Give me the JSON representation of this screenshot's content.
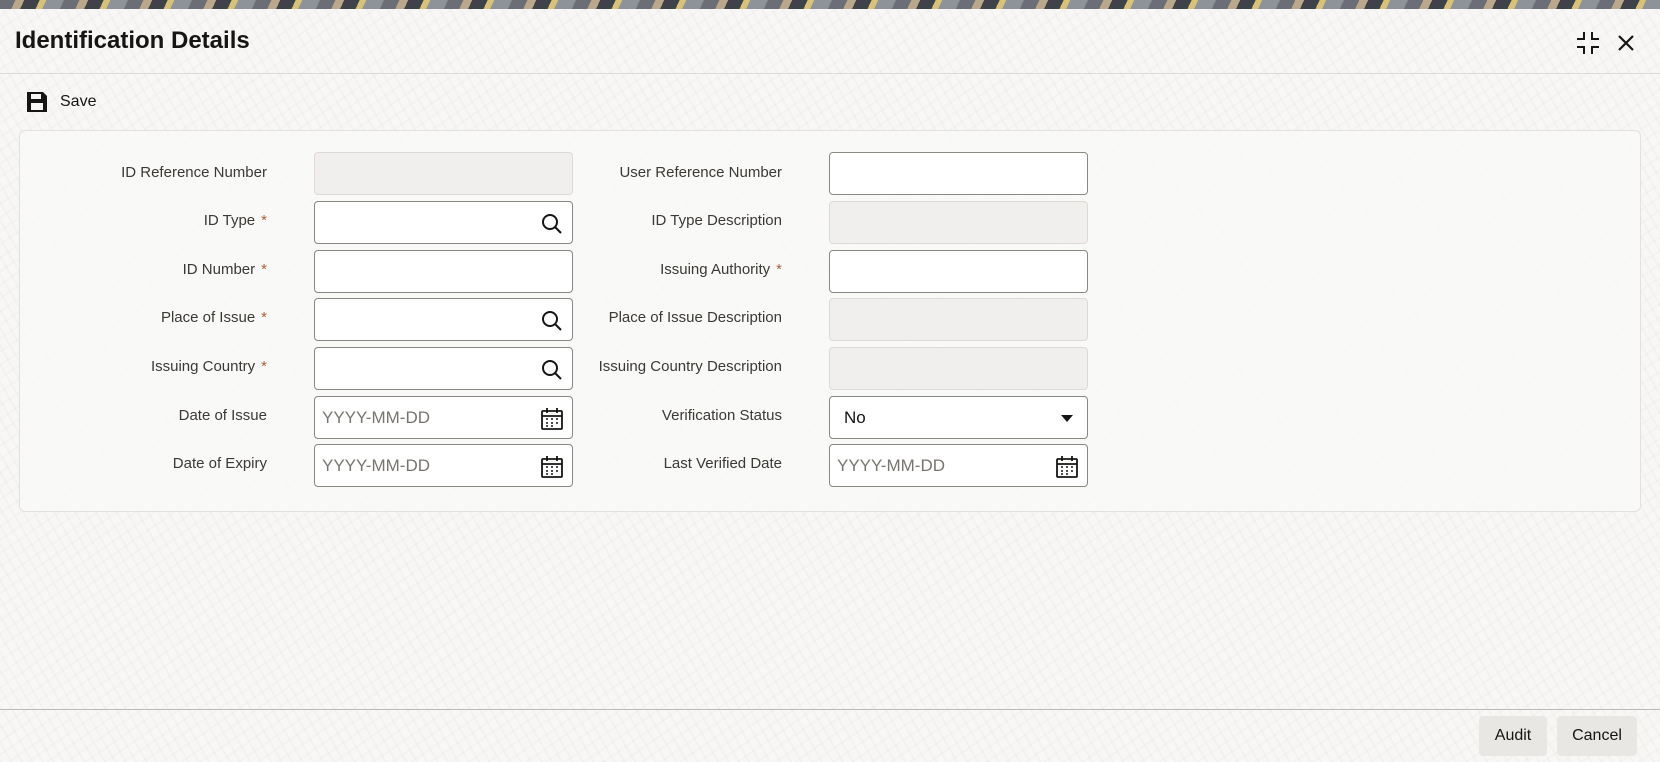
{
  "window": {
    "title": "Identification Details"
  },
  "toolbar": {
    "save_label": "Save"
  },
  "form": {
    "id_reference_number": {
      "label": "ID Reference Number",
      "value": ""
    },
    "user_reference_number": {
      "label": "User Reference Number",
      "value": ""
    },
    "id_type": {
      "label": "ID Type",
      "required": "*",
      "value": ""
    },
    "id_type_description": {
      "label": "ID Type Description",
      "value": ""
    },
    "id_number": {
      "label": "ID Number",
      "required": "*",
      "value": ""
    },
    "issuing_authority": {
      "label": "Issuing Authority",
      "required": "*",
      "value": ""
    },
    "place_of_issue": {
      "label": "Place of Issue",
      "required": "*",
      "value": ""
    },
    "place_of_issue_description": {
      "label": "Place of Issue Description",
      "value": ""
    },
    "issuing_country": {
      "label": "Issuing Country",
      "required": "*",
      "value": ""
    },
    "issuing_country_description": {
      "label": "Issuing Country Description",
      "value": ""
    },
    "date_of_issue": {
      "label": "Date of Issue",
      "placeholder": "YYYY-MM-DD"
    },
    "verification_status": {
      "label": "Verification Status",
      "value": "No"
    },
    "date_of_expiry": {
      "label": "Date of Expiry",
      "placeholder": "YYYY-MM-DD"
    },
    "last_verified_date": {
      "label": "Last Verified Date",
      "placeholder": "YYYY-MM-DD"
    }
  },
  "footer": {
    "audit_label": "Audit",
    "cancel_label": "Cancel"
  },
  "icons": {
    "save": "floppy-disk-icon",
    "maximize": "maximize-icon",
    "close": "close-icon",
    "search": "search-icon",
    "calendar": "calendar-icon",
    "dropdown": "chevron-down-icon"
  },
  "colors": {
    "required": "#a95e3a",
    "text": "#161513",
    "field_border": "#8a8782"
  }
}
